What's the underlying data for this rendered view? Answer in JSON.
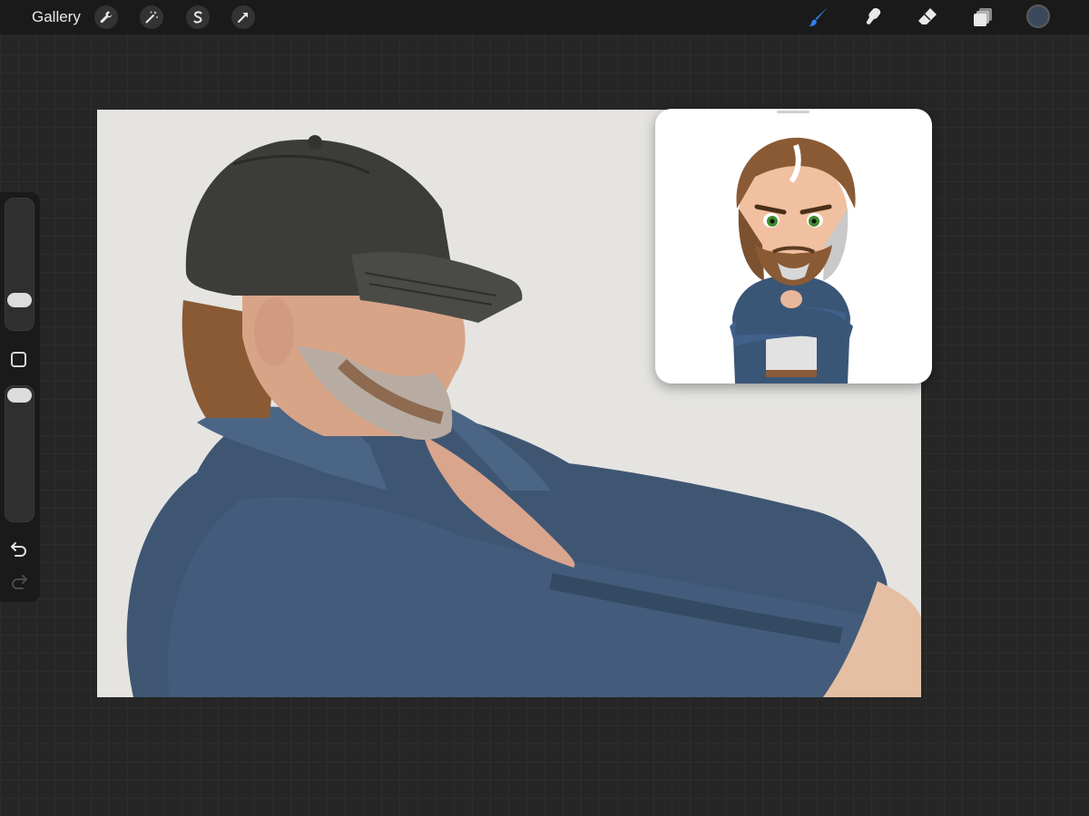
{
  "topbar": {
    "gallery_label": "Gallery",
    "left_tools": [
      "wrench-icon",
      "magic-wand-icon",
      "selection-icon",
      "transform-icon"
    ],
    "right_tools": [
      "brush-icon",
      "smudge-icon",
      "eraser-icon",
      "layers-icon"
    ],
    "active_tool": "brush-icon",
    "current_color": "#3a4a5e",
    "accent_color": "#2f7ff0"
  },
  "sidebar": {
    "brush_size_level": 0.2,
    "opacity_level": 1.0,
    "controls": [
      "brush-size-slider",
      "modify-button",
      "opacity-slider",
      "undo-icon",
      "redo-icon"
    ]
  },
  "canvas": {
    "background_color": "#e5e4e1",
    "subject": "man-in-black-cap-and-blue-shirt"
  },
  "reference": {
    "subject": "chibi-man-arms-crossed"
  }
}
